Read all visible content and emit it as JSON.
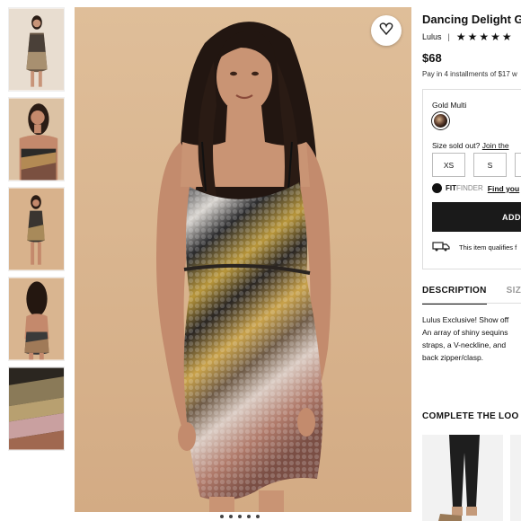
{
  "product": {
    "title": "Dancing Delight G",
    "brand": "Lulus",
    "separator": "|",
    "stars": "★★★★★",
    "price": "$68",
    "installments": "Pay in 4 installments of $17 w"
  },
  "options": {
    "color_label": "Gold Multi",
    "size_sold_out": "Size sold out?",
    "join_link": "Join the",
    "sizes": [
      "XS",
      "S",
      ""
    ],
    "fit_brand": "FIT",
    "fit_finder": "FINDER",
    "fit_link": "Find you",
    "add_button": "ADD",
    "shipping_text": "This item qualifies f"
  },
  "tabs": {
    "description": "DESCRIPTION",
    "size": "SIZ"
  },
  "description": {
    "lines": [
      "Lulus Exclusive! Show off",
      "An array of shiny sequins",
      "straps, a V-neckline, and",
      "back zipper/clasp."
    ]
  },
  "complete_the_look": "COMPLETE THE LOO",
  "icons": {
    "favorite": "heart-icon",
    "shipping": "truck-icon",
    "fit": "fit-finder-logo-icon"
  },
  "colors": {
    "background_beige": "#d9b590",
    "button_black": "#1a1a1a"
  }
}
